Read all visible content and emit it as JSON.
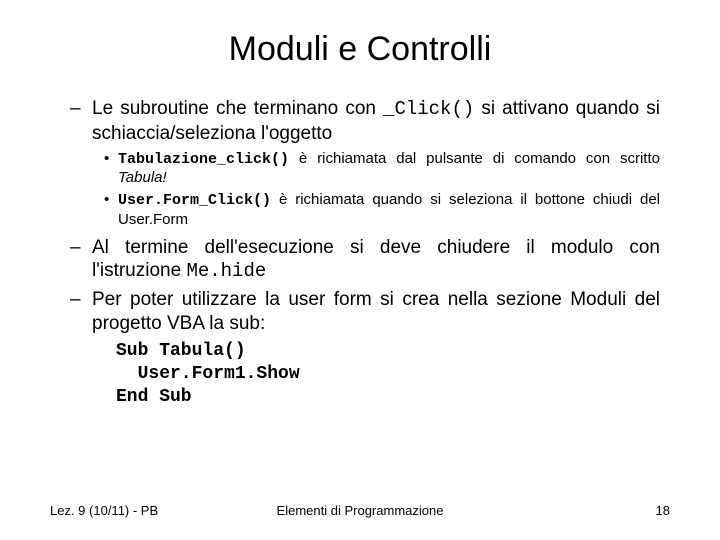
{
  "title": "Moduli e Controlli",
  "b1_pre": "Le subroutine che terminano con ",
  "b1_code": "_Click()",
  "b1_post": " si attivano quando si schiaccia/seleziona l'oggetto",
  "b1a_code": "Tabulazione_click()",
  "b1a_mid": " è richiamata dal pulsante di comando con scritto ",
  "b1a_em": "Tabula!",
  "b1b_code": "User.Form_Click()",
  "b1b_rest": " è richiamata quando si seleziona il bottone chiudi del User.Form",
  "b2_pre": "Al termine dell'esecuzione si deve chiudere il modulo con l'istruzione ",
  "b2_code": "Me.hide",
  "b3": "Per poter utilizzare la user form si crea nella sezione Moduli del progetto VBA la sub:",
  "code_l1": "Sub Tabula()",
  "code_l2": "  User.Form1.Show",
  "code_l3": "End Sub",
  "footer_left": "Lez. 9 (10/11) - PB",
  "footer_center": "Elementi di Programmazione",
  "footer_right": "18"
}
